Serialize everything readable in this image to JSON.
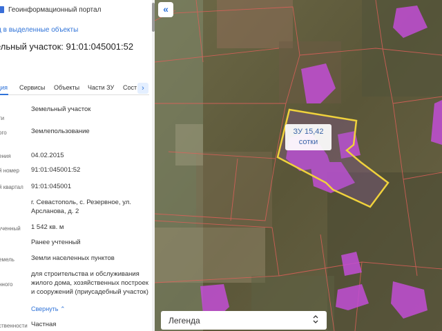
{
  "header": {
    "portal_title": "Геоинформационный портал"
  },
  "link": {
    "add_to_selected": "д в выделенные объекты"
  },
  "object": {
    "title": "ельный участок: 91:01:045001:52"
  },
  "tabs": [
    {
      "label": "ция",
      "active": true
    },
    {
      "label": "Сервисы",
      "active": false
    },
    {
      "label": "Объекты",
      "active": false
    },
    {
      "label": "Части ЗУ",
      "active": false
    },
    {
      "label": "Сост",
      "active": false
    }
  ],
  "tab_next_icon": "chevron-right-icon",
  "properties": [
    {
      "label": "ти",
      "value": "Земельный участок"
    },
    {
      "label": "ого",
      "value": "Землепользование"
    },
    {
      "label": "ения",
      "value": "04.02.2015"
    },
    {
      "label": "й номер",
      "value": "91:01:045001:52"
    },
    {
      "label": "й квартал",
      "value": "91:01:045001"
    },
    {
      "label": "",
      "value": "г. Севастополь, с. Резервное, ул. Арсланова, д. 2"
    },
    {
      "label": "ученный",
      "value": "1 542 кв. м"
    },
    {
      "label": "",
      "value": "Ранее учтенный"
    },
    {
      "label": "емель",
      "value": "Земли населенных пунктов"
    },
    {
      "label": "нного",
      "value": "для строительства и обслуживания жилого дома, хозяйственных построек и сооружений (приусадебный участок)"
    },
    {
      "label": "ственности",
      "value": "Частная"
    }
  ],
  "collapse_link": "Свернуть",
  "collapse_icon": "chevron-up-icon",
  "map": {
    "collapse_button": "«",
    "parcel_label_line1": "ЗУ 15,42",
    "parcel_label_line2": "сотки",
    "legend_label": "Легенда",
    "legend_icon": "⌃⌄"
  },
  "colors": {
    "accent": "#2f73d8",
    "parcel_outline": "#f0d23c",
    "building_fill": "#c24ed6",
    "boundary_line": "#e0605a"
  }
}
